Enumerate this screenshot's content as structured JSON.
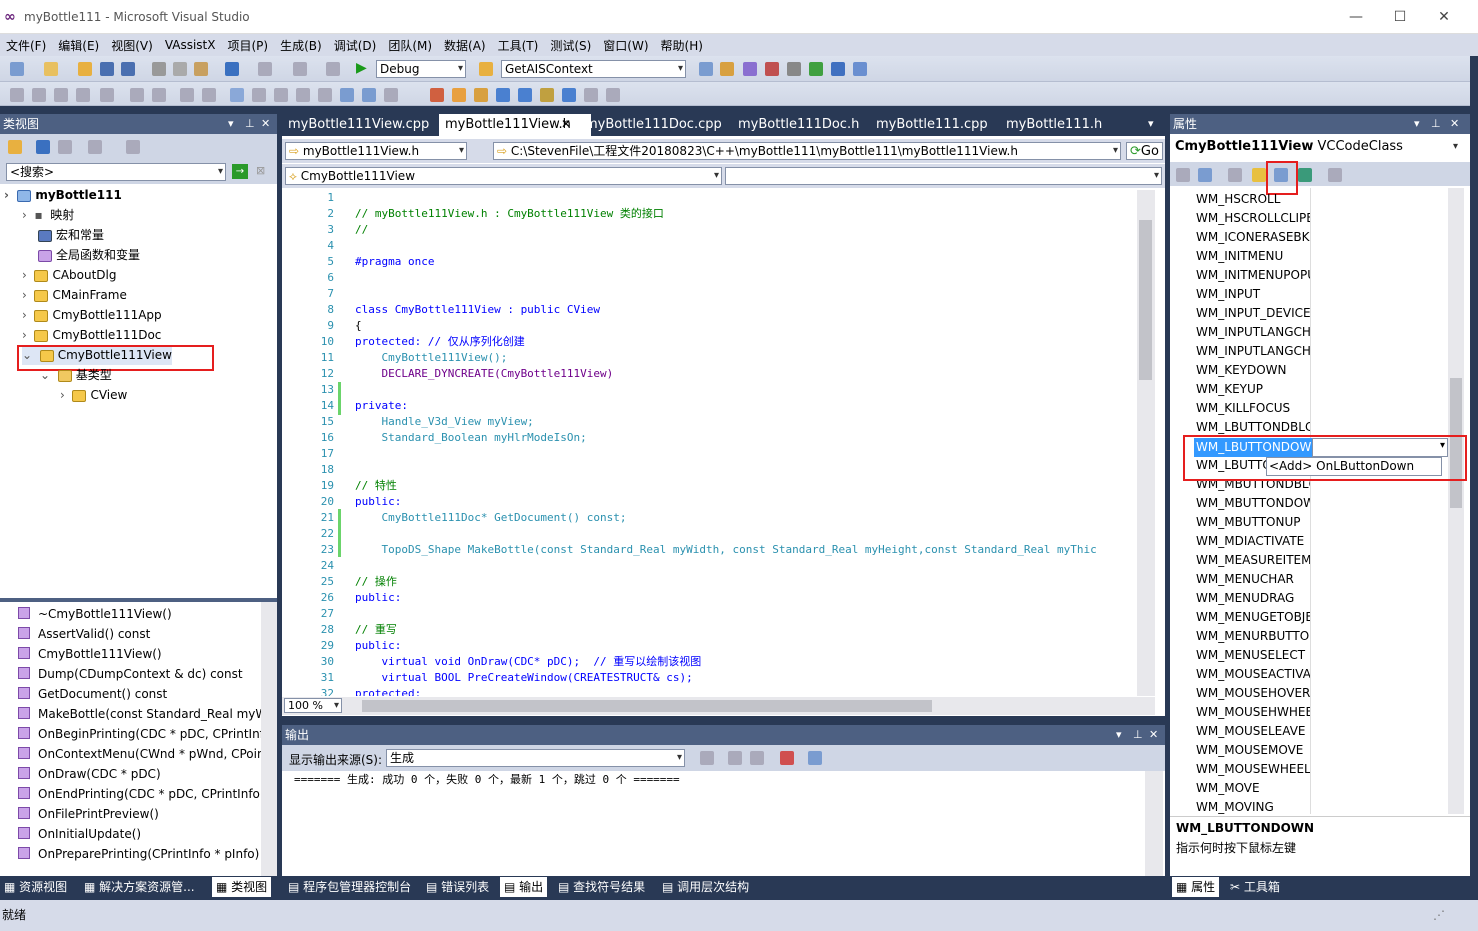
{
  "window": {
    "title": "myBottle111 - Microsoft Visual Studio",
    "min": "—",
    "max": "☐",
    "close": "✕"
  },
  "menu": [
    "文件(F)",
    "编辑(E)",
    "视图(V)",
    "VAssistX",
    "项目(P)",
    "生成(B)",
    "调试(D)",
    "团队(M)",
    "数据(A)",
    "工具(T)",
    "测试(S)",
    "窗口(W)",
    "帮助(H)"
  ],
  "toolbar": {
    "config": "Debug",
    "find_combo": "GetAISContext"
  },
  "classview": {
    "title": "类视图",
    "search_placeholder": "<搜索>",
    "tree": [
      {
        "label": "myBottle111"
      },
      {
        "label": "映射"
      },
      {
        "label": "宏和常量"
      },
      {
        "label": "全局函数和变量"
      },
      {
        "label": "CAboutDlg"
      },
      {
        "label": "CMainFrame"
      },
      {
        "label": "CmyBottle111App"
      },
      {
        "label": "CmyBottle111Doc"
      },
      {
        "label": "CmyBottle111View"
      },
      {
        "label": "基类型"
      },
      {
        "label": "CView"
      }
    ],
    "members": [
      "~CmyBottle111View()",
      "AssertValid() const",
      "CmyBottle111View()",
      "Dump(CDumpContext & dc) const",
      "GetDocument() const",
      "MakeBottle(const Standard_Real myW",
      "OnBeginPrinting(CDC * pDC, CPrintInfo",
      "OnContextMenu(CWnd * pWnd, CPoin",
      "OnDraw(CDC * pDC)",
      "OnEndPrinting(CDC * pDC, CPrintInfo *",
      "OnFilePrintPreview()",
      "OnInitialUpdate()",
      "OnPreparePrinting(CPrintInfo * pInfo)"
    ]
  },
  "editor": {
    "tabs": [
      "myBottle111View.cpp",
      "myBottle111View.h",
      "myBottle111Doc.cpp",
      "myBottle111Doc.h",
      "myBottle111.cpp",
      "myBottle111.h"
    ],
    "file_combo": "myBottle111View.h",
    "path": "C:\\StevenFile\\工程文件20180823\\C++\\myBottle111\\myBottle111\\myBottle111View.h",
    "go": "Go",
    "class_combo": "CmyBottle111View",
    "zoom": "100 %",
    "lines": [
      {
        "n": "1",
        "t": ""
      },
      {
        "n": "2",
        "t": "// myBottle111View.h : CmyBottle111View 类的接口"
      },
      {
        "n": "3",
        "t": "//"
      },
      {
        "n": "4",
        "t": ""
      },
      {
        "n": "5",
        "t": "#pragma once"
      },
      {
        "n": "6",
        "t": ""
      },
      {
        "n": "7",
        "t": ""
      },
      {
        "n": "8",
        "t": "class CmyBottle111View : public CView"
      },
      {
        "n": "9",
        "t": "{"
      },
      {
        "n": "10",
        "t": "protected: // 仅从序列化创建"
      },
      {
        "n": "11",
        "t": "    CmyBottle111View();"
      },
      {
        "n": "12",
        "t": "    DECLARE_DYNCREATE(CmyBottle111View)"
      },
      {
        "n": "13",
        "t": ""
      },
      {
        "n": "14",
        "t": "private:"
      },
      {
        "n": "15",
        "t": "    Handle_V3d_View myView;"
      },
      {
        "n": "16",
        "t": "    Standard_Boolean myHlrModeIsOn;"
      },
      {
        "n": "17",
        "t": ""
      },
      {
        "n": "18",
        "t": ""
      },
      {
        "n": "19",
        "t": "// 特性"
      },
      {
        "n": "20",
        "t": "public:"
      },
      {
        "n": "21",
        "t": "    CmyBottle111Doc* GetDocument() const;"
      },
      {
        "n": "22",
        "t": ""
      },
      {
        "n": "23",
        "t": "    TopoDS_Shape MakeBottle(const Standard_Real myWidth, const Standard_Real myHeight,const Standard_Real myThic"
      },
      {
        "n": "24",
        "t": ""
      },
      {
        "n": "25",
        "t": "// 操作"
      },
      {
        "n": "26",
        "t": "public:"
      },
      {
        "n": "27",
        "t": ""
      },
      {
        "n": "28",
        "t": "// 重写"
      },
      {
        "n": "29",
        "t": "public:"
      },
      {
        "n": "30",
        "t": "    virtual void OnDraw(CDC* pDC);  // 重写以绘制该视图"
      },
      {
        "n": "31",
        "t": "    virtual BOOL PreCreateWindow(CREATESTRUCT& cs);"
      },
      {
        "n": "32",
        "t": "protected:"
      }
    ]
  },
  "output": {
    "title": "输出",
    "source_label": "显示输出来源(S):",
    "source_value": "生成",
    "text": "======= 生成: 成功 0 个，失败 0 个，最新 1 个，跳过 0 个 ======="
  },
  "properties": {
    "title": "属性",
    "object": "CmyBottle111View",
    "object_type": "VCCodeClass",
    "messages": [
      "WM_HSCROLL",
      "WM_HSCROLLCLIPBOARD",
      "WM_ICONERASEBKGND",
      "WM_INITMENU",
      "WM_INITMENUPOPUP",
      "WM_INPUT",
      "WM_INPUT_DEVICE_CHANGE",
      "WM_INPUTLANGCHANGE",
      "WM_INPUTLANGCHANGEREQUEST",
      "WM_KEYDOWN",
      "WM_KEYUP",
      "WM_KILLFOCUS",
      "WM_LBUTTONDBLCLK",
      "WM_LBUTTONDOWN",
      "WM_LBUTTONUP",
      "WM_MBUTTONDBLCLK",
      "WM_MBUTTONDOWN",
      "WM_MBUTTONUP",
      "WM_MDIACTIVATE",
      "WM_MEASUREITEM",
      "WM_MENUCHAR",
      "WM_MENUDRAG",
      "WM_MENUGETOBJECT",
      "WM_MENURBUTTONUP",
      "WM_MENUSELECT",
      "WM_MOUSEACTIVATE",
      "WM_MOUSEHOVER",
      "WM_MOUSEHWHEEL",
      "WM_MOUSELEAVE",
      "WM_MOUSEMOVE",
      "WM_MOUSEWHEEL",
      "WM_MOVE",
      "WM_MOVING"
    ],
    "dropdown_option": "<Add> OnLButtonDown",
    "desc_title": "WM_LBUTTONDOWN",
    "desc_text": "指示何时按下鼠标左键"
  },
  "bottom_tabs": {
    "left": [
      "资源视图",
      "解决方案资源管...",
      "类视图"
    ],
    "center": [
      "程序包管理器控制台",
      "错误列表",
      "输出",
      "查找符号结果",
      "调用层次结构"
    ],
    "right": [
      "属性",
      "工具箱"
    ]
  },
  "status": "就绪"
}
